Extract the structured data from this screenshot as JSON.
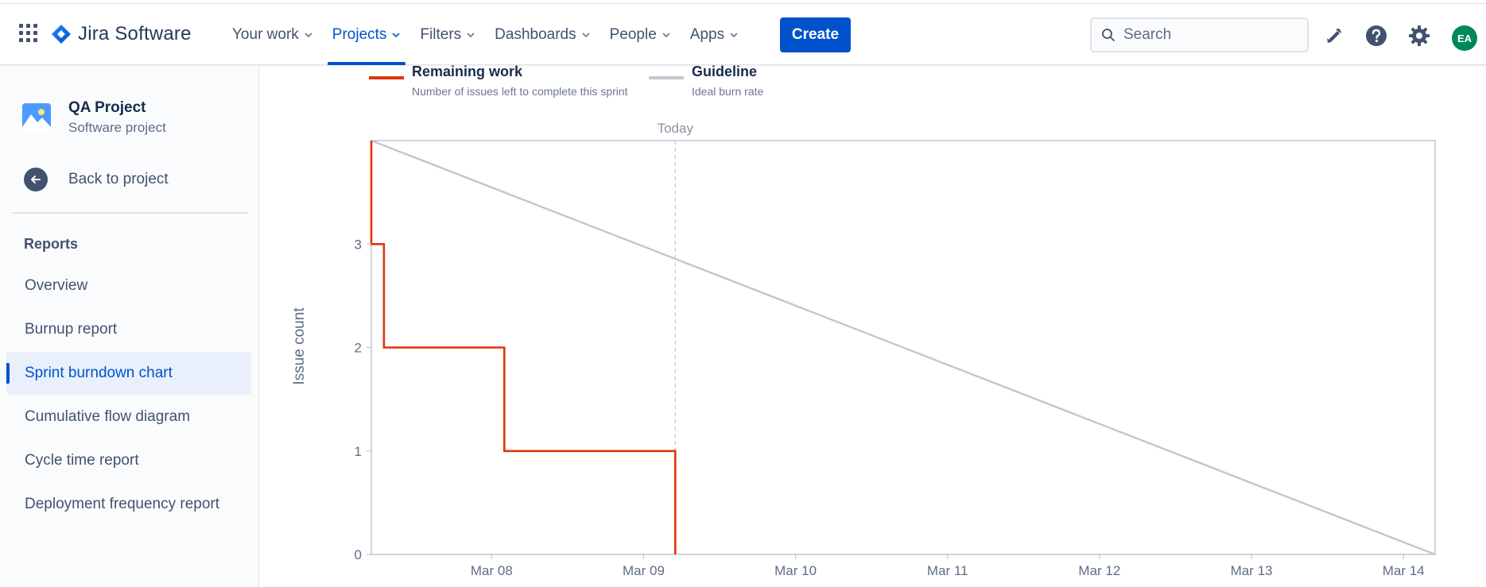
{
  "header": {
    "logo_text": "Jira Software",
    "nav": [
      {
        "label": "Your work",
        "active": false
      },
      {
        "label": "Projects",
        "active": true
      },
      {
        "label": "Filters",
        "active": false
      },
      {
        "label": "Dashboards",
        "active": false
      },
      {
        "label": "People",
        "active": false
      },
      {
        "label": "Apps",
        "active": false
      }
    ],
    "create_label": "Create",
    "search_placeholder": "Search",
    "avatar_initials": "EA",
    "colors": {
      "accent": "#0052cc",
      "avatar": "#00875a"
    }
  },
  "sidebar": {
    "project_name": "QA Project",
    "project_type": "Software project",
    "back_label": "Back to project",
    "section_title": "Reports",
    "items": [
      {
        "label": "Overview",
        "active": false
      },
      {
        "label": "Burnup report",
        "active": false
      },
      {
        "label": "Sprint burndown chart",
        "active": true
      },
      {
        "label": "Cumulative flow diagram",
        "active": false
      },
      {
        "label": "Cycle time report",
        "active": false
      },
      {
        "label": "Deployment frequency report",
        "active": false
      }
    ]
  },
  "legend": {
    "remaining": {
      "title": "Remaining work",
      "subtitle": "Number of issues left to complete this sprint",
      "color": "#de350b"
    },
    "guideline": {
      "title": "Guideline",
      "subtitle": "Ideal burn rate",
      "color": "#c1c7d0"
    }
  },
  "chart_data": {
    "type": "line",
    "ylabel": "Issue count",
    "today_label": "Today",
    "x_ticks": [
      "Mar 08",
      "Mar 09",
      "Mar 10",
      "Mar 11",
      "Mar 12",
      "Mar 13",
      "Mar 14"
    ],
    "y_ticks": [
      0,
      1,
      2,
      3
    ],
    "xlim": [
      "Mar 07 17:00",
      "Mar 14 17:00"
    ],
    "ylim": [
      0,
      4
    ],
    "today": "Mar 09 17:00",
    "grid": false,
    "series": [
      {
        "name": "Remaining work",
        "step": true,
        "points": [
          {
            "x": "Mar 07 17:00",
            "y": 4
          },
          {
            "x": "Mar 07 17:00",
            "y": 3
          },
          {
            "x": "Mar 07 19:00",
            "y": 3
          },
          {
            "x": "Mar 07 19:00",
            "y": 2
          },
          {
            "x": "Mar 08 14:00",
            "y": 2
          },
          {
            "x": "Mar 08 14:00",
            "y": 1
          },
          {
            "x": "Mar 09 17:00",
            "y": 1
          },
          {
            "x": "Mar 09 17:00",
            "y": 0
          }
        ]
      },
      {
        "name": "Guideline",
        "points": [
          {
            "x": "Mar 07 17:00",
            "y": 4
          },
          {
            "x": "Mar 14 17:00",
            "y": 0
          }
        ]
      }
    ]
  }
}
